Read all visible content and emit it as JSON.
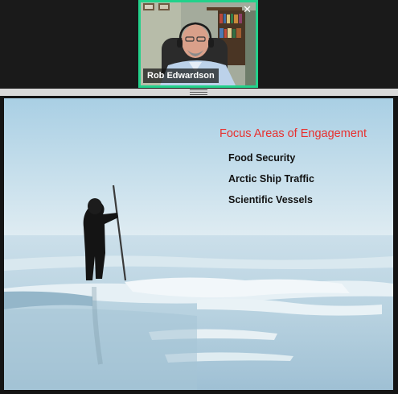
{
  "participant": {
    "name": "Rob Edwardson",
    "close_icon": "close-icon",
    "border_color": "#23d18b"
  },
  "slide": {
    "title": "Focus Areas of Engagement",
    "bullets": [
      "Food Security",
      "Arctic Ship Traffic",
      "Scientific Vessels"
    ],
    "title_color": "#e8302e"
  }
}
